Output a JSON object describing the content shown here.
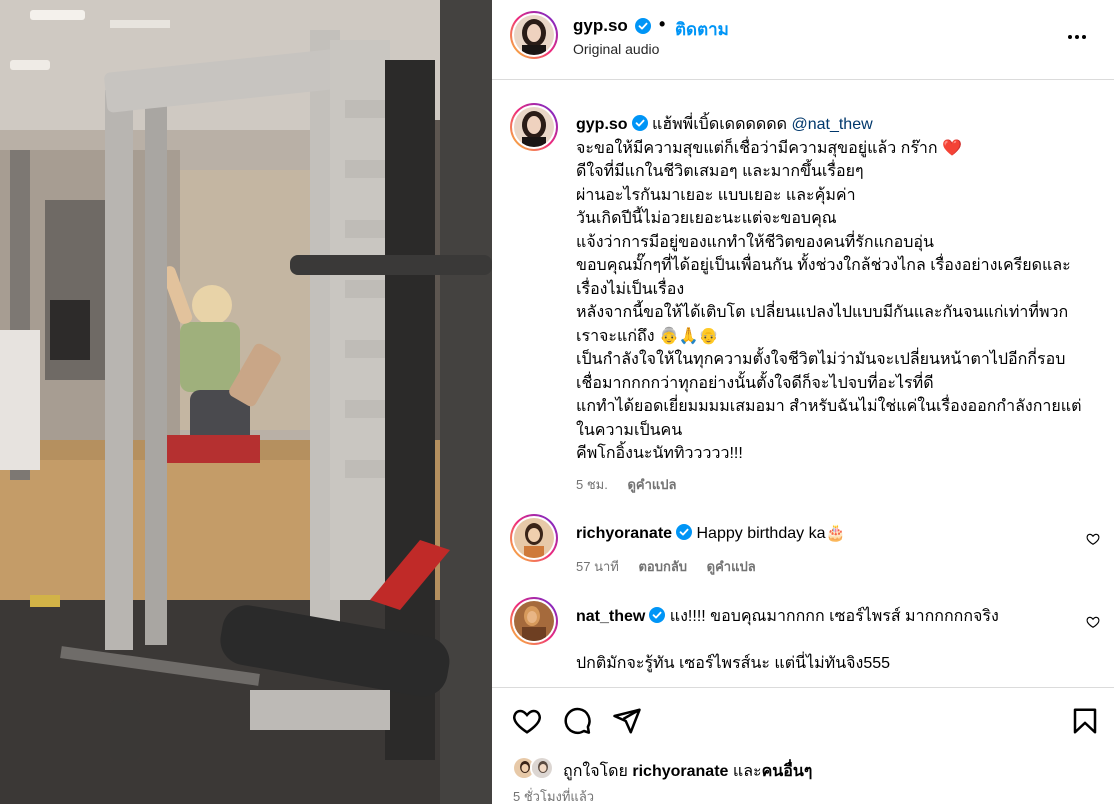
{
  "post": {
    "username": "gyp.so",
    "separator": "•",
    "follow_label": "ติดตาม",
    "audio_label": "Original audio",
    "more_icon": "more-options-icon"
  },
  "caption": {
    "username": "gyp.so",
    "lead": "แฮ้พพี่เบิ้ดเดดดดดด",
    "mention": "@nat_thew",
    "lines": [
      "จะขอให้มีความสุขแต่ก็เชื่อว่ามีความสุขอยู่แล้ว กร๊าก ❤️",
      "ดีใจที่มีแกในชีวิตเสมอๆ และมากขึ้นเรื่อยๆ",
      "ผ่านอะไรกันมาเยอะ แบบเยอะ และคุ้มค่า",
      "วันเกิดปีนี้ไม่อวยเยอะนะแต่จะขอบคุณ",
      "แจ้งว่าการมีอยู่ของแกทำให้ชีวิตของคนที่รักแกอบอุ่น",
      "ขอบคุณมั๊กๆที่ได้อยู่เป็นเพื่อนกัน ทั้งช่วงใกล้ช่วงไกล เรื่องอย่างเครียดและ",
      "เรื่องไม่เป็นเรื่อง",
      "หลังจากนี้ขอให้ได้เติบโต เปลี่ยนแปลงไปแบบมีกันและกันจนแก่เท่าที่พวก",
      "เราจะแก่ถึง 👵🙏👴",
      "เป็นกำลังใจให้ในทุกความตั้งใจชีวิตไม่ว่ามันจะเปลี่ยนหน้าตาไปอีกกี่รอบ",
      "เชื่อมากกกกว่าทุกอย่างนั้นตั้งใจดีก็จะไปจบที่อะไรที่ดี",
      "แกทำได้ยอดเยี่ยมมมมเสมอมา สำหรับฉันไม่ใช่แค่ในเรื่องออกกำลังกายแต่",
      "ในความเป็นคน",
      "คีพโกอิ้งนะนัททิววววว!!!"
    ],
    "time": "5 ชม.",
    "translate": "ดูคำแปล"
  },
  "comments": [
    {
      "username": "richyoranate",
      "text": "Happy birthday ka🎂",
      "time": "57 นาที",
      "reply": "ตอบกลับ",
      "translate": "ดูคำแปล"
    },
    {
      "username": "nat_thew",
      "text": "แง!!!! ขอบคุณมากกกก เซอร์ไพรส์ มากกกกกจริง",
      "text2": "ปกติมักจะรู้ทัน เซอร์ไพรส์นะ แต่นี่ไม่ทันจิง555"
    }
  ],
  "actions": {
    "like_icon": "heart-icon",
    "comment_icon": "comment-icon",
    "share_icon": "share-icon",
    "save_icon": "bookmark-icon"
  },
  "likes": {
    "prefix": "ถูกใจโดย",
    "user": "richyoranate",
    "joiner": "และ",
    "others": "คนอื่นๆ"
  },
  "time_ago": "5 ชั่วโมงที่แล้ว",
  "colors": {
    "link_blue": "#0095f6",
    "verified_blue": "#0095f6",
    "muted": "#737373",
    "heart_red": "#ed4956"
  }
}
